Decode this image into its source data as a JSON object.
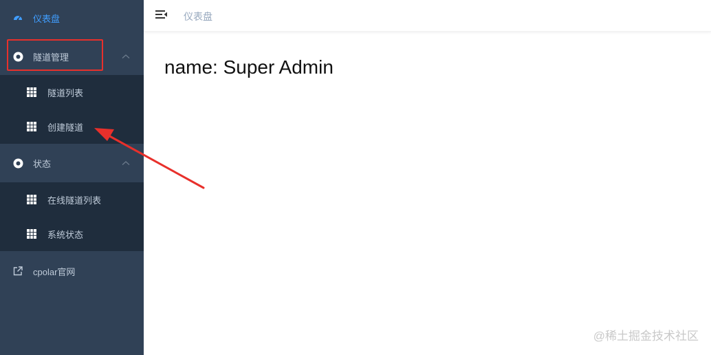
{
  "sidebar": {
    "items": [
      {
        "label": "仪表盘",
        "icon": "dashboard-icon"
      },
      {
        "label": "隧道管理",
        "icon": "circle-icon"
      },
      {
        "label": "隧道列表",
        "icon": "grid-icon"
      },
      {
        "label": "创建隧道",
        "icon": "grid-icon"
      },
      {
        "label": "状态",
        "icon": "circle-icon"
      },
      {
        "label": "在线隧道列表",
        "icon": "grid-icon"
      },
      {
        "label": "系统状态",
        "icon": "grid-icon"
      },
      {
        "label": "cpolar官网",
        "icon": "external-link-icon"
      }
    ]
  },
  "navbar": {
    "breadcrumb": "仪表盘"
  },
  "main": {
    "content": "name: Super Admin"
  },
  "watermark": "@稀土掘金技术社区",
  "colors": {
    "sidebar_bg": "#304156",
    "submenu_bg": "#1f2d3d",
    "active": "#409eff",
    "annotation": "#e8302b"
  }
}
